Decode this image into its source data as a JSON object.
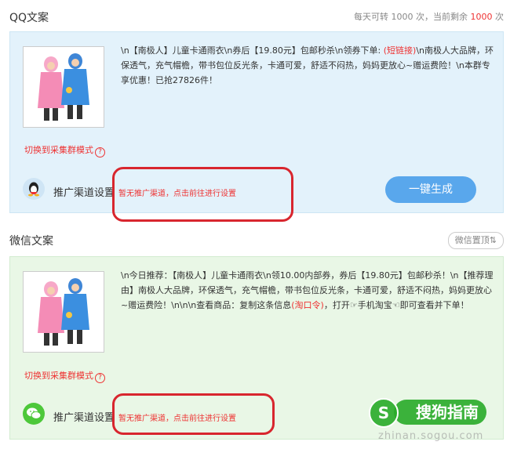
{
  "qq": {
    "title": "QQ文案",
    "quota": {
      "prefix": "每天可转 1000 次，当前剩余 ",
      "remaining": "1000",
      "suffix": " 次"
    },
    "copy": {
      "part1": "\\n【南极人】儿童卡通雨衣\\n券后【19.80元】包邮秒杀\\n领券下单: ",
      "link": "(短链接)",
      "part2": "\\n南极人大品牌，环保透气，充气帽檐，带书包位反光条，卡通可爱，舒适不闷热，妈妈更放心~赠运费险！\\n本群专享优惠！已抢27826件！"
    },
    "switch_mode": "切换到采集群模式",
    "help": "?",
    "channel_label": "推广渠道设置",
    "channel_none": "暂无推广渠道，点击前往进行设置",
    "generate_button": "一键生成"
  },
  "wechat": {
    "title": "微信文案",
    "top_button": "微信置顶⇅",
    "copy": {
      "part1": "\\n今日推荐：【南极人】儿童卡通雨衣\\n领10.00内部券，券后【19.80元】包邮秒杀！\\n【推荐理由】南极人大品牌，环保透气，充气帽檐，带书包位反光条，卡通可爱，舒适不闷热，妈妈更放心~赠运费险！\\n\\n\\n查看商品：复制这条信息",
      "link": "(淘口令)",
      "part2": "，打开☞手机淘宝☜即可查看并下单！"
    },
    "switch_mode": "切换到采集群模式",
    "help": "?",
    "channel_label": "推广渠道设置",
    "channel_none": "暂无推广渠道，点击前往进行设置"
  },
  "watermark": {
    "logo": "S",
    "text": "搜狗指南",
    "url": "zhinan.sogou.com"
  },
  "colors": {
    "accent_red": "#e33333",
    "qq_panel": "#e3f2fb",
    "wechat_panel": "#e9f7e6",
    "button_blue": "#59a7ec",
    "annotation": "#d8262e"
  }
}
